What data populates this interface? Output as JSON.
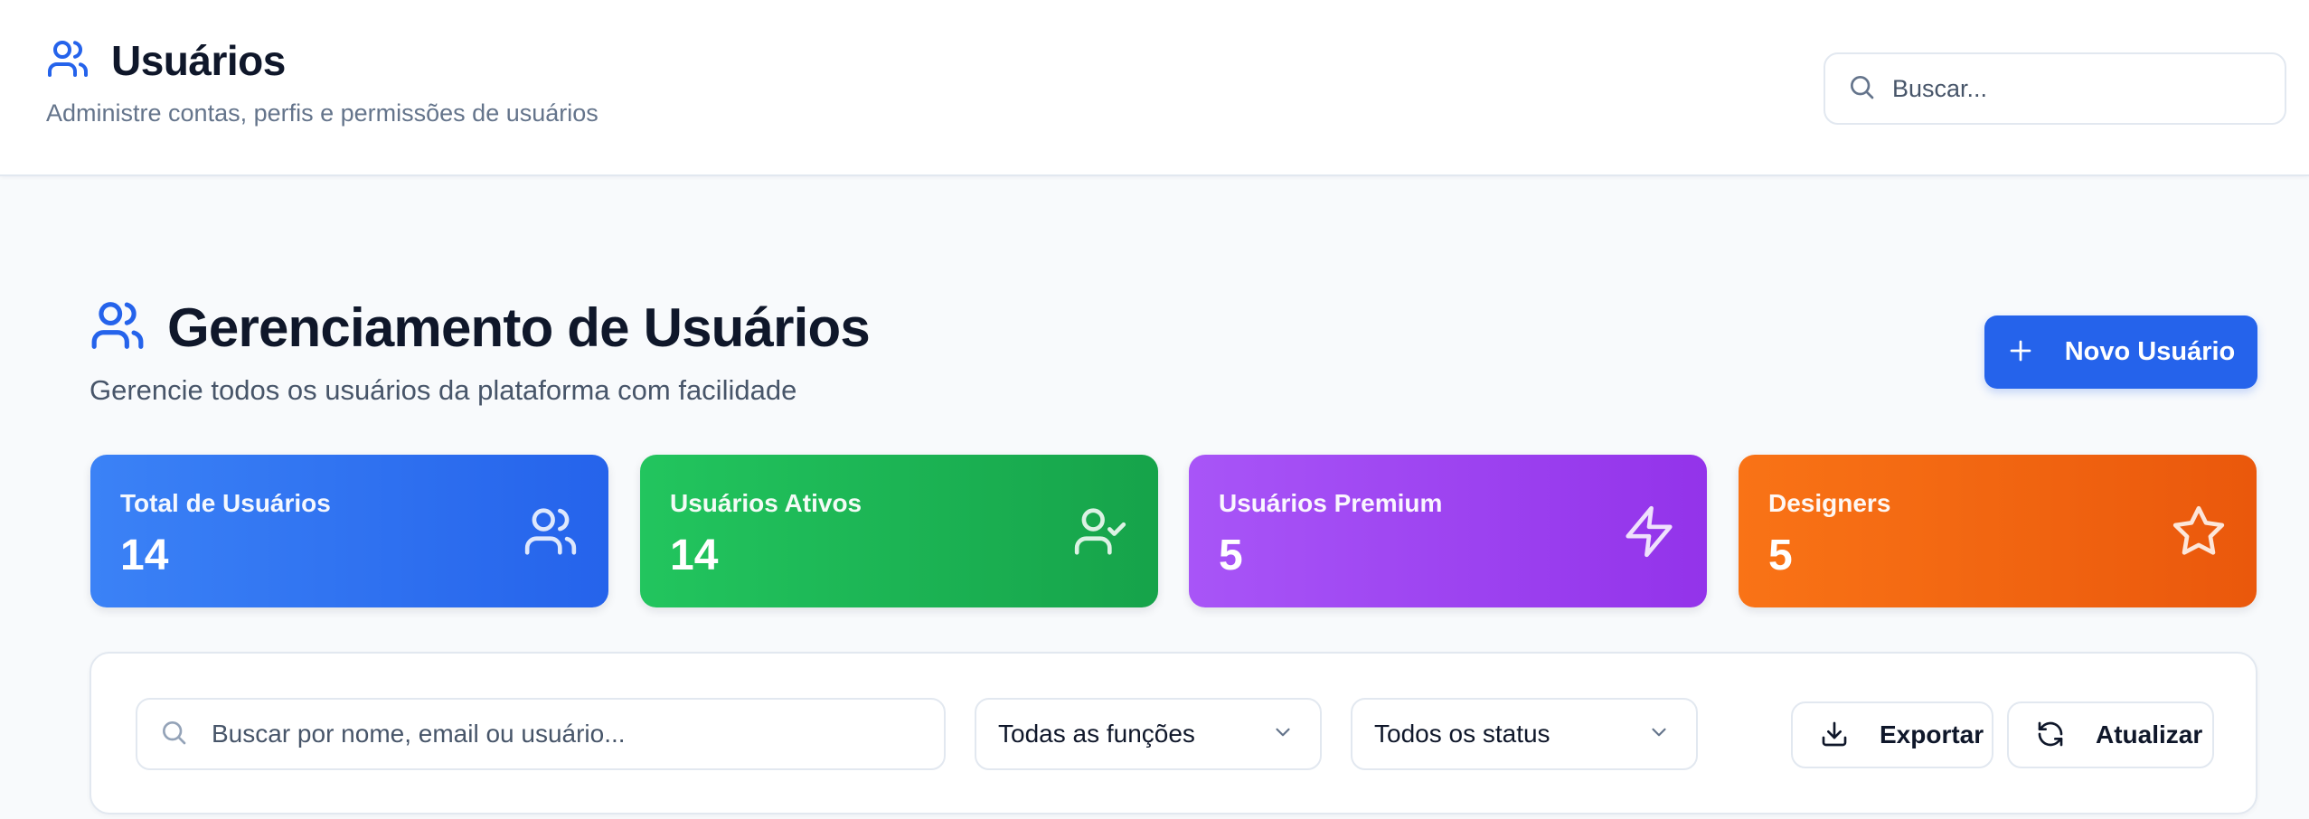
{
  "header": {
    "title": "Usuários",
    "subtitle": "Administre contas, perfis e permissões de usuários",
    "search_placeholder": "Buscar..."
  },
  "page": {
    "title": "Gerenciamento de Usuários",
    "subtitle": "Gerencie todos os usuários da plataforma com facilidade",
    "new_user_label": "Novo Usuário"
  },
  "stats": [
    {
      "label": "Total de Usuários",
      "value": "14",
      "icon": "users-icon",
      "color": "#2563eb"
    },
    {
      "label": "Usuários Ativos",
      "value": "14",
      "icon": "user-check-icon",
      "color": "#16a34a"
    },
    {
      "label": "Usuários Premium",
      "value": "5",
      "icon": "zap-icon",
      "color": "#9333ea"
    },
    {
      "label": "Designers",
      "value": "5",
      "icon": "star-icon",
      "color": "#ea580c"
    }
  ],
  "filters": {
    "search_placeholder": "Buscar por nome, email ou usuário...",
    "role_selected": "Todas as funções",
    "status_selected": "Todos os status",
    "export_label": "Exportar",
    "refresh_label": "Atualizar"
  },
  "colors": {
    "accent": "#2563eb",
    "background": "#f8fafc",
    "border": "#e2e8f0"
  }
}
